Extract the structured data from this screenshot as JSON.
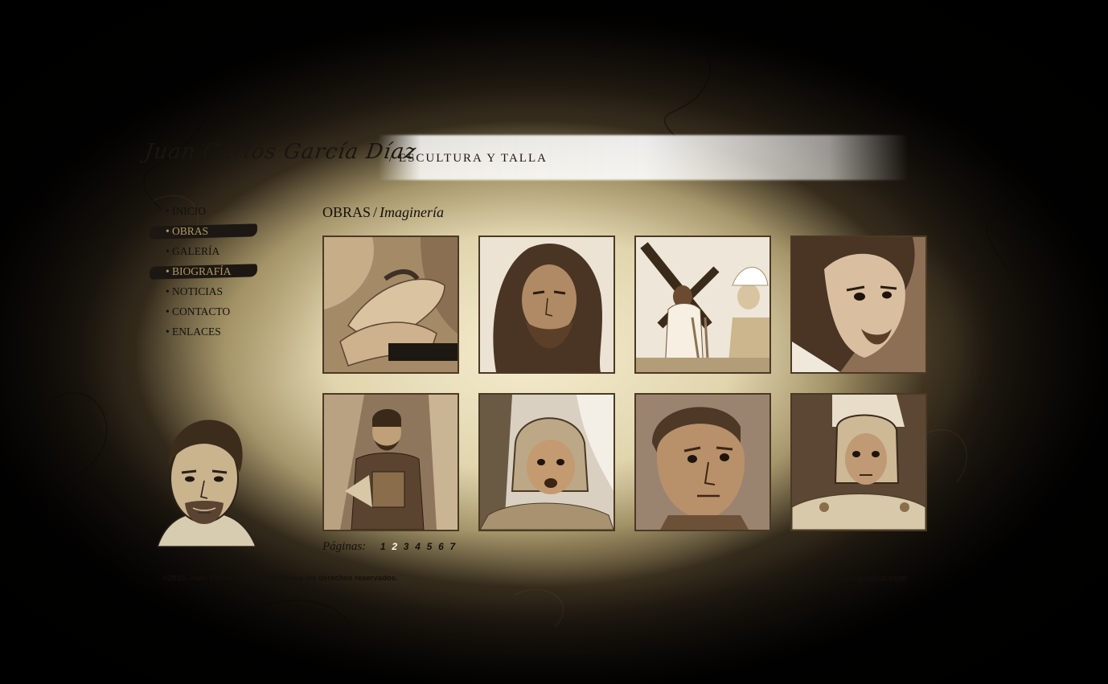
{
  "brand": {
    "name": "Juan Carlos García Díaz",
    "subtitle": "/ ESCULTURA Y TALLA"
  },
  "nav": {
    "bullet": "•",
    "items": [
      {
        "label": "INICIO",
        "active": false
      },
      {
        "label": "OBRAS",
        "active": true
      },
      {
        "label": "GALERÍA",
        "active": false
      },
      {
        "label": "BIOGRAFÍA",
        "active": true
      },
      {
        "label": "NOTICIAS",
        "active": false
      },
      {
        "label": "CONTACTO",
        "active": false
      },
      {
        "label": "ENLACES",
        "active": false
      }
    ]
  },
  "section": {
    "title": "OBRAS",
    "separator": "/",
    "subtitle": "Imaginería"
  },
  "gallery": {
    "thumbnails": [
      {
        "name": "hands-sculpture-thumb"
      },
      {
        "name": "bearded-christ-head-thumb"
      },
      {
        "name": "procession-cross-thumb"
      },
      {
        "name": "christ-face-profile-thumb"
      },
      {
        "name": "saint-with-palm-thumb"
      },
      {
        "name": "roman-soldier-helmet-thumb"
      },
      {
        "name": "roman-bust-thumb"
      },
      {
        "name": "roman-soldier-armor-thumb"
      }
    ]
  },
  "pager": {
    "label": "Páginas:",
    "pages": [
      "1",
      "2",
      "3",
      "4",
      "5",
      "6",
      "7"
    ],
    "current": "2"
  },
  "footer": {
    "copyright": "©2010. Juan Carlos García Díaz. Todos los derechos reservados.",
    "credit": "Difusióngrafica.com"
  },
  "colors": {
    "ink": "#14110d",
    "active_nav_text": "#b39a62",
    "nav_brush": "#1c1713",
    "thumb_border": "#4a3a24"
  }
}
